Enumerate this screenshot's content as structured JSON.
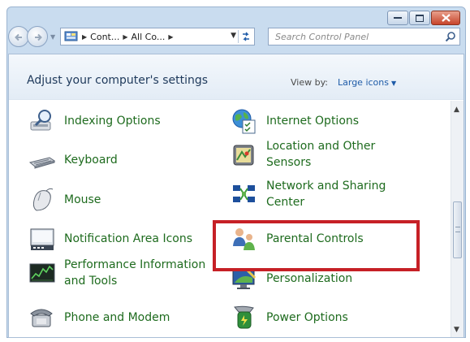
{
  "window": {
    "caption_buttons": [
      "minimize",
      "maximize",
      "close"
    ]
  },
  "address_bar": {
    "crumbs": [
      "Cont...",
      "All Co..."
    ],
    "search_placeholder": "Search Control Panel"
  },
  "header": {
    "title": "Adjust your computer's settings",
    "view_by_label": "View by:",
    "view_mode": "Large icons"
  },
  "items": [
    {
      "label": "Indexing Options",
      "icon": "indexing-options-icon"
    },
    {
      "label": "Internet Options",
      "icon": "internet-options-icon"
    },
    {
      "label": "Keyboard",
      "icon": "keyboard-icon"
    },
    {
      "label": "Location and Other Sensors",
      "icon": "location-sensors-icon"
    },
    {
      "label": "Mouse",
      "icon": "mouse-icon"
    },
    {
      "label": "Network and Sharing Center",
      "icon": "network-sharing-icon"
    },
    {
      "label": "Notification Area Icons",
      "icon": "notification-area-icon"
    },
    {
      "label": "Parental Controls",
      "icon": "parental-controls-icon"
    },
    {
      "label": "Performance Information and Tools",
      "icon": "performance-icon"
    },
    {
      "label": "Personalization",
      "icon": "personalization-icon"
    },
    {
      "label": "Phone and Modem",
      "icon": "phone-modem-icon"
    },
    {
      "label": "Power Options",
      "icon": "power-options-icon"
    }
  ],
  "colors": {
    "item_text": "#1e6b1e",
    "highlight_border": "#c62026",
    "header_text": "#1e395b"
  }
}
